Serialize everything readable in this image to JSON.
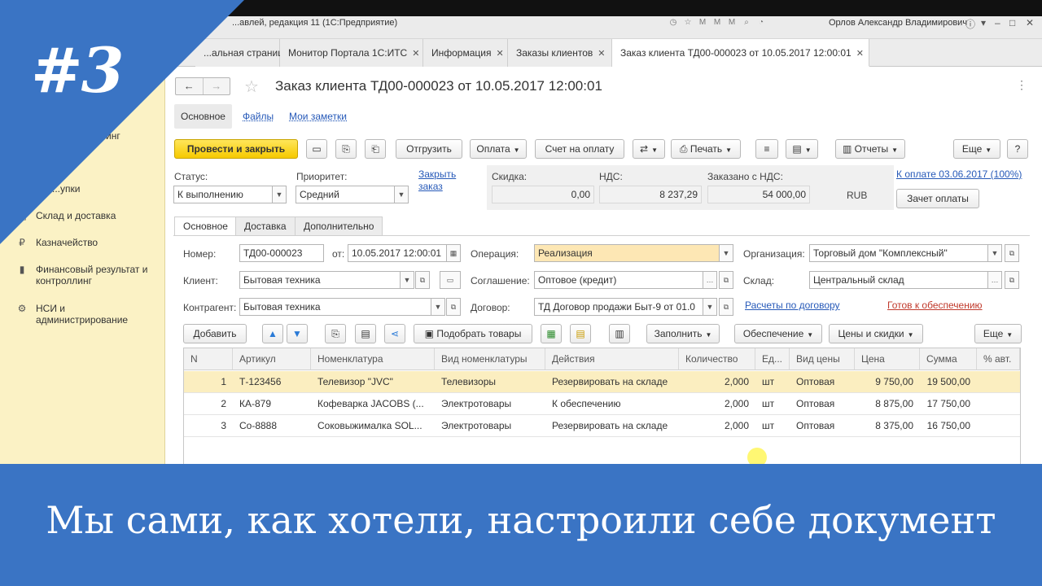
{
  "window": {
    "title": "...авлей, редакция 11  (1С:Предприятие)",
    "user": "Орлов Александр Владимирович"
  },
  "tabs": [
    {
      "label": "...альная страница",
      "closable": false
    },
    {
      "label": "Монитор Портала 1С:ИТС",
      "closable": true
    },
    {
      "label": "Информация",
      "closable": true
    },
    {
      "label": "Заказы клиентов",
      "closable": true
    },
    {
      "label": "Заказ клиента ТД00-000023 от 10.05.2017 12:00:01",
      "closable": true,
      "active": true
    }
  ],
  "sidebar": {
    "items": [
      {
        "label": "...инг",
        "icon": "menu-icon"
      },
      {
        "label": "...упки",
        "icon": "cart-icon"
      },
      {
        "label": "Склад и доставка",
        "icon": "box-icon"
      },
      {
        "label": "Казначейство",
        "icon": "coin-icon"
      },
      {
        "label": "Финансовый результат и контроллинг",
        "icon": "chart-icon"
      },
      {
        "label": "НСИ и администрирование",
        "icon": "gear-icon"
      }
    ]
  },
  "doc": {
    "title": "Заказ клиента ТД00-000023 от 10.05.2017 12:00:01",
    "form_tabs": {
      "main": "Основное",
      "files": "Файлы",
      "notes": "Мои заметки"
    }
  },
  "toolbar": {
    "post_close": "Провести и закрыть",
    "ship": "Отгрузить",
    "payment": "Оплата",
    "invoice": "Счет на оплату",
    "print": "Печать",
    "reports": "Отчеты",
    "more": "Еще",
    "help": "?"
  },
  "status": {
    "status_label": "Статус:",
    "status_value": "К выполнению",
    "priority_label": "Приоритет:",
    "priority_value": "Средний",
    "close_order_link": "Закрыть заказ",
    "discount_label": "Скидка:",
    "discount_value": "0,00",
    "vat_label": "НДС:",
    "vat_value": "8 237,29",
    "ordered_label": "Заказано с НДС:",
    "ordered_value": "54 000,00",
    "currency": "RUB",
    "pay_link": "К оплате 03.06.2017 (100%)",
    "offset_button": "Зачет оплаты"
  },
  "inner_tabs": [
    "Основное",
    "Доставка",
    "Дополнительно"
  ],
  "form": {
    "number_label": "Номер:",
    "number_value": "ТД00-000023",
    "date_label": "от:",
    "date_value": "10.05.2017 12:00:01",
    "operation_label": "Операция:",
    "operation_value": "Реализация",
    "org_label": "Организация:",
    "org_value": "Торговый дом \"Комплексный\"",
    "client_label": "Клиент:",
    "client_value": "Бытовая техника",
    "agreement_label": "Соглашение:",
    "agreement_value": "Оптовое (кредит)",
    "warehouse_label": "Склад:",
    "warehouse_value": "Центральный склад",
    "contractor_label": "Контрагент:",
    "contractor_value": "Бытовая техника",
    "contract_label": "Договор:",
    "contract_value": "ТД Договор продажи Быт-9 от 01.0",
    "settlements_link": "Расчеты по договору",
    "ready_link": "Готов к обеспечению"
  },
  "grid_toolbar": {
    "add": "Добавить",
    "pick": "Подобрать товары",
    "fill": "Заполнить",
    "supply": "Обеспечение",
    "prices": "Цены и скидки",
    "more": "Еще"
  },
  "table": {
    "headers": [
      "N",
      "Артикул",
      "Номенклатура",
      "Вид номенклатуры",
      "Действия",
      "Количество",
      "Ед...",
      "Вид цены",
      "Цена",
      "Сумма",
      "% авт."
    ],
    "rows": [
      [
        "1",
        "Т-123456",
        "Телевизор \"JVC\"",
        "Телевизоры",
        "Резервировать на складе",
        "2,000",
        "шт",
        "Оптовая",
        "9 750,00",
        "19 500,00",
        ""
      ],
      [
        "2",
        "КА-879",
        "Кофеварка JACOBS (...",
        "Электротовары",
        "К обеспечению",
        "2,000",
        "шт",
        "Оптовая",
        "8 875,00",
        "17 750,00",
        ""
      ],
      [
        "3",
        "Со-8888",
        "Соковыжималка  SOL...",
        "Электротовары",
        "Резервировать на складе",
        "2,000",
        "шт",
        "Оптовая",
        "8 375,00",
        "16 750,00",
        ""
      ]
    ],
    "selected_row": 0
  },
  "overlay": {
    "badge": "#3",
    "banner": "Мы сами, как хотели,  настроили себе документ",
    "accent": "#3a74c4"
  }
}
